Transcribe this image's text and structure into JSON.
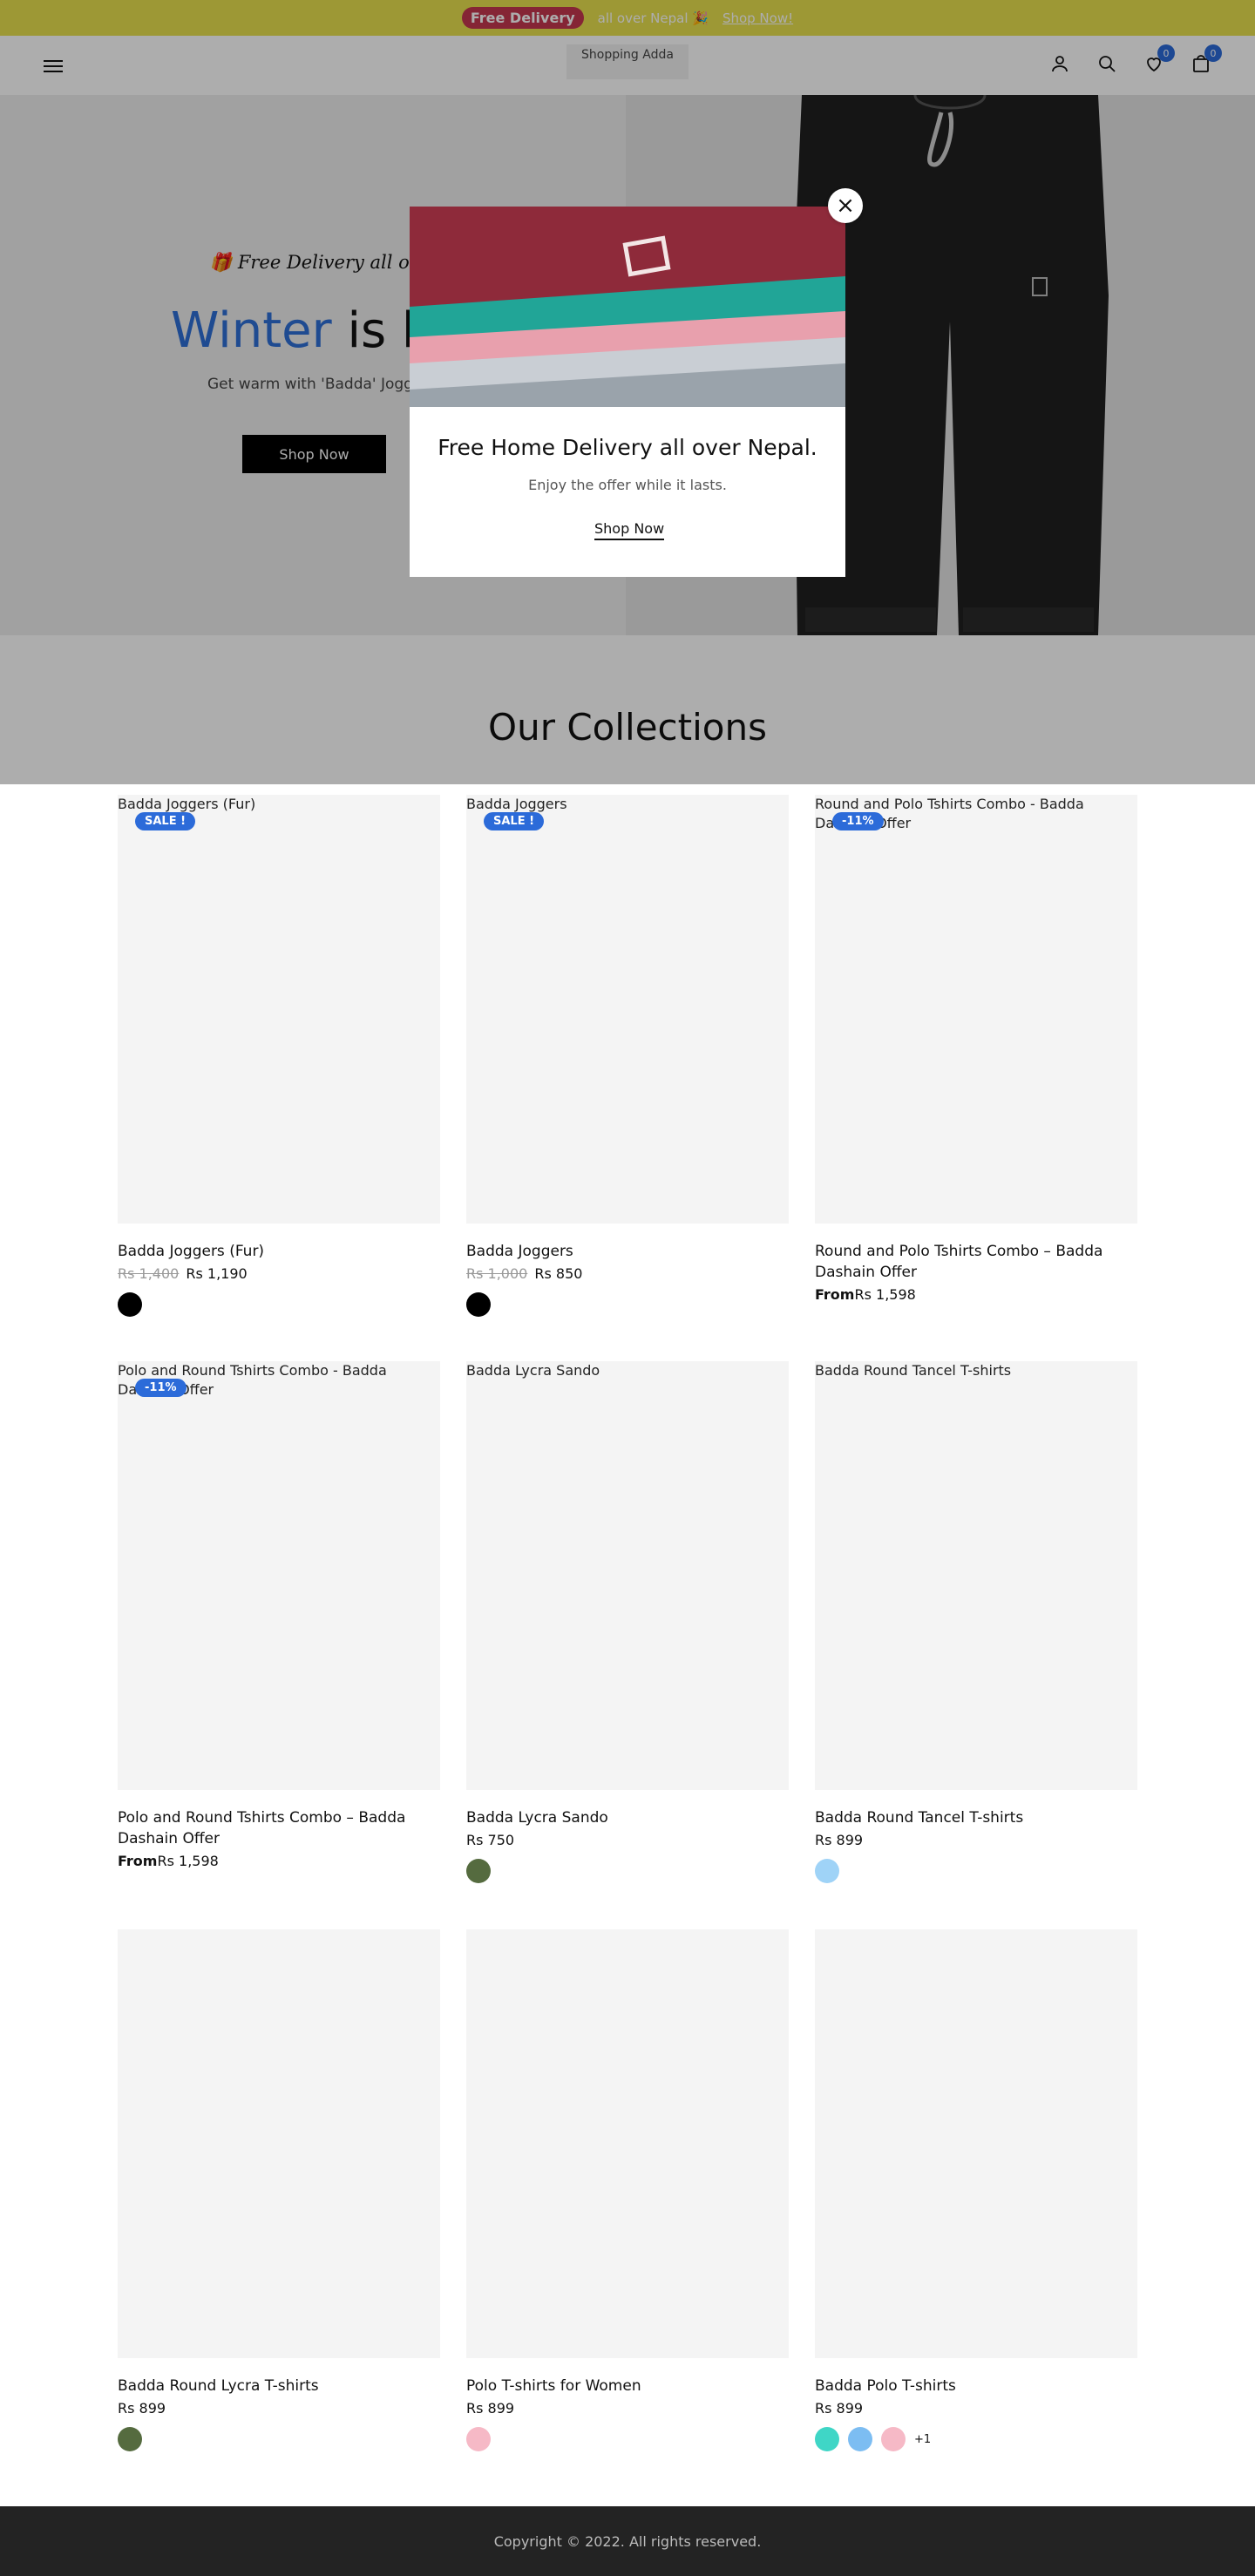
{
  "announcement": {
    "badge": "Free Delivery",
    "text": "all over Nepal 🎉",
    "link": "Shop Now!"
  },
  "header": {
    "logo_alt": "Shopping Adda",
    "wishlist_count": "0",
    "cart_count": "0"
  },
  "hero": {
    "tagline": "🎁 Free Delivery all over NEPAL",
    "title_highlight": "Winter",
    "title_rest": "is he",
    "subtitle": "Get warm with 'Badda' Joggers",
    "button": "Shop Now"
  },
  "modal": {
    "title": "Free Home Delivery all over Nepal.",
    "subtitle": "Enjoy the offer while it lasts.",
    "link": "Shop Now"
  },
  "collections": {
    "title": "Our Collections",
    "products": [
      {
        "alt": "Badda Joggers (Fur)",
        "badge": "SALE !",
        "name": "Badda Joggers (Fur)",
        "old_price": "Rs 1,400",
        "price": "Rs 1,190",
        "from": "",
        "swatches": [
          "#000000"
        ],
        "more": ""
      },
      {
        "alt": "Badda Joggers",
        "badge": "SALE !",
        "name": "Badda Joggers",
        "old_price": "Rs 1,000",
        "price": "Rs 850",
        "from": "",
        "swatches": [
          "#000000"
        ],
        "more": ""
      },
      {
        "alt": "Round and Polo Tshirts Combo - Badda Dashain Offer",
        "badge": "-11%",
        "name": "Round and Polo Tshirts Combo – Badda Dashain Offer",
        "old_price": "",
        "price": "Rs 1,598",
        "from": "From",
        "swatches": [],
        "more": ""
      },
      {
        "alt": "Polo and Round Tshirts Combo - Badda Dashain Offer",
        "badge": "-11%",
        "name": "Polo and Round Tshirts Combo – Badda Dashain Offer",
        "old_price": "",
        "price": "Rs 1,598",
        "from": "From",
        "swatches": [],
        "more": ""
      },
      {
        "alt": "Badda Lycra Sando",
        "badge": "",
        "name": "Badda Lycra Sando",
        "old_price": "",
        "price": "Rs 750",
        "from": "",
        "swatches": [
          "#556b3f"
        ],
        "more": ""
      },
      {
        "alt": "Badda Round Tancel T-shirts",
        "badge": "",
        "name": "Badda Round Tancel T-shirts",
        "old_price": "",
        "price": "Rs 899",
        "from": "",
        "swatches": [
          "#9fd3f7"
        ],
        "more": ""
      },
      {
        "alt": "",
        "badge": "",
        "name": "Badda Round Lycra T-shirts",
        "old_price": "",
        "price": "Rs 899",
        "from": "",
        "swatches": [
          "#556b3f"
        ],
        "more": ""
      },
      {
        "alt": "",
        "badge": "",
        "name": "Polo T-shirts for Women",
        "old_price": "",
        "price": "Rs 899",
        "from": "",
        "swatches": [
          "#f6b9c6"
        ],
        "more": ""
      },
      {
        "alt": "",
        "badge": "",
        "name": "Badda Polo T-shirts",
        "old_price": "",
        "price": "Rs 899",
        "from": "",
        "swatches": [
          "#3fd6c6",
          "#7cbdf2",
          "#f6b9c6"
        ],
        "more": "+1"
      }
    ]
  },
  "footer": {
    "copyright": "Copyright © 2022. All rights reserved."
  },
  "colors": {
    "accent": "#2c6bd9",
    "announcement_bg": "#e7e04e",
    "announcement_badge": "#c4374e",
    "footer_bg": "#232323"
  },
  "icons": [
    "menu-icon",
    "user-icon",
    "search-icon",
    "heart-icon",
    "bag-icon",
    "close-icon",
    "gift-icon"
  ]
}
